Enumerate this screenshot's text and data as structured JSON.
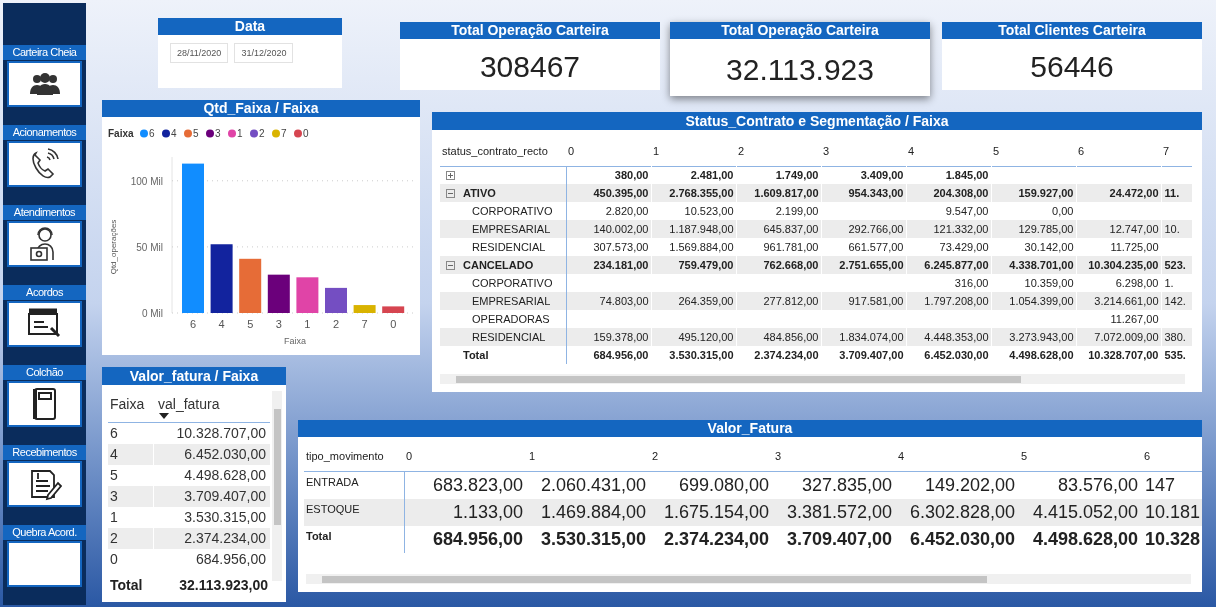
{
  "sidebar": {
    "items": [
      {
        "label": "Carteira Cheia"
      },
      {
        "label": "Acionamentos"
      },
      {
        "label": "Atendimentos"
      },
      {
        "label": "Acordos"
      },
      {
        "label": "Colchão"
      },
      {
        "label": "Recebimentos"
      },
      {
        "label": "Quebra Acord."
      }
    ]
  },
  "date_filter": {
    "title": "Data",
    "start": "28/11/2020",
    "end": "31/12/2020"
  },
  "kpi_cards": [
    {
      "title": "Total Operação Carteira",
      "value": "308467",
      "highlighted": false
    },
    {
      "title": "Total Operação Carteira",
      "value": "32.113.923",
      "highlighted": true
    },
    {
      "title": "Total Clientes Carteira",
      "value": "56446",
      "highlighted": false
    }
  ],
  "qtd_chart": {
    "legend": {
      "title": "Faixa",
      "items": [
        {
          "label": "6",
          "color": "#118dff"
        },
        {
          "label": "4",
          "color": "#12239e"
        },
        {
          "label": "5",
          "color": "#e66c37"
        },
        {
          "label": "3",
          "color": "#6b007b"
        },
        {
          "label": "1",
          "color": "#e044a7"
        },
        {
          "label": "2",
          "color": "#744ec2"
        },
        {
          "label": "7",
          "color": "#d9b300"
        },
        {
          "label": "0",
          "color": "#d64550"
        }
      ]
    },
    "chart_data": {
      "type": "bar",
      "title": "Qtd_Faixa / Faixa",
      "xlabel": "Faixa",
      "ylabel": "Qtd_operações",
      "categories": [
        "6",
        "4",
        "5",
        "3",
        "1",
        "2",
        "7",
        "0"
      ],
      "values": [
        113,
        52,
        41,
        29,
        27,
        19,
        6,
        5
      ],
      "ylim": [
        0,
        118
      ],
      "yticks": [
        {
          "value": 0,
          "label": "0 Mil"
        },
        {
          "value": 50,
          "label": "50 Mil"
        },
        {
          "value": 100,
          "label": "100 Mil"
        }
      ]
    }
  },
  "status_matrix": {
    "title": "Status_Contrato e Segmentação / Faixa",
    "row_header": "status_contrato_recto",
    "columns": [
      "0",
      "1",
      "2",
      "3",
      "4",
      "5",
      "6",
      "7"
    ],
    "rows": [
      {
        "expanded": false,
        "values": {
          "c0": "380,00",
          "c1": "2.481,00",
          "c2": "1.749,00",
          "c3": "3.409,00",
          "c4": "1.845,00"
        }
      },
      {
        "label": "ATIVO",
        "expanded": true,
        "values": {
          "c0": "450.395,00",
          "c1": "2.768.355,00",
          "c2": "1.609.817,00",
          "c3": "954.343,00",
          "c4": "204.308,00",
          "c5": "159.927,00",
          "c6": "24.472,00",
          "c7": "11."
        },
        "children": [
          {
            "label": "CORPORATIVO",
            "values": {
              "c0": "2.820,00",
              "c1": "10.523,00",
              "c2": "2.199,00",
              "c4": "9.547,00",
              "c5": "0,00"
            }
          },
          {
            "label": "EMPRESARIAL",
            "values": {
              "c0": "140.002,00",
              "c1": "1.187.948,00",
              "c2": "645.837,00",
              "c3": "292.766,00",
              "c4": "121.332,00",
              "c5": "129.785,00",
              "c6": "12.747,00",
              "c7": "10."
            }
          },
          {
            "label": "RESIDENCIAL",
            "values": {
              "c0": "307.573,00",
              "c1": "1.569.884,00",
              "c2": "961.781,00",
              "c3": "661.577,00",
              "c4": "73.429,00",
              "c5": "30.142,00",
              "c6": "11.725,00"
            }
          }
        ]
      },
      {
        "label": "CANCELADO",
        "expanded": true,
        "values": {
          "c0": "234.181,00",
          "c1": "759.479,00",
          "c2": "762.668,00",
          "c3": "2.751.655,00",
          "c4": "6.245.877,00",
          "c5": "4.338.701,00",
          "c6": "10.304.235,00",
          "c7": "523."
        },
        "children": [
          {
            "label": "CORPORATIVO",
            "values": {
              "c4": "316,00",
              "c5": "10.359,00",
              "c6": "6.298,00",
              "c7": "1."
            }
          },
          {
            "label": "EMPRESARIAL",
            "values": {
              "c0": "74.803,00",
              "c1": "264.359,00",
              "c2": "277.812,00",
              "c3": "917.581,00",
              "c4": "1.797.208,00",
              "c5": "1.054.399,00",
              "c6": "3.214.661,00",
              "c7": "142."
            }
          },
          {
            "label": "OPERADORAS",
            "values": {
              "c6": "11.267,00"
            }
          },
          {
            "label": "RESIDENCIAL",
            "values": {
              "c0": "159.378,00",
              "c1": "495.120,00",
              "c2": "484.856,00",
              "c3": "1.834.074,00",
              "c4": "4.448.353,00",
              "c5": "3.273.943,00",
              "c6": "7.072.009,00",
              "c7": "380."
            }
          }
        ]
      }
    ],
    "total": {
      "label": "Total",
      "values": {
        "c0": "684.956,00",
        "c1": "3.530.315,00",
        "c2": "2.374.234,00",
        "c3": "3.709.407,00",
        "c4": "6.452.030,00",
        "c5": "4.498.628,00",
        "c6": "10.328.707,00",
        "c7": "535."
      }
    }
  },
  "valor_fatura_table": {
    "title": "Valor_fatura / Faixa",
    "columns": [
      "Faixa",
      "val_fatura"
    ],
    "rows": [
      {
        "faixa": "6",
        "val_fatura": "10.328.707,00"
      },
      {
        "faixa": "4",
        "val_fatura": "6.452.030,00"
      },
      {
        "faixa": "5",
        "val_fatura": "4.498.628,00"
      },
      {
        "faixa": "3",
        "val_fatura": "3.709.407,00"
      },
      {
        "faixa": "1",
        "val_fatura": "3.530.315,00"
      },
      {
        "faixa": "2",
        "val_fatura": "2.374.234,00"
      },
      {
        "faixa": "0",
        "val_fatura": "684.956,00"
      }
    ],
    "total": {
      "faixa": "Total",
      "val_fatura": "32.113.923,00"
    }
  },
  "valor_fatura_matrix": {
    "title": "Valor_Fatura",
    "row_header": "tipo_movimento",
    "columns": [
      "0",
      "1",
      "2",
      "3",
      "4",
      "5",
      "6"
    ],
    "rows": [
      {
        "label": "ENTRADA",
        "values": [
          "683.823,00",
          "2.060.431,00",
          "699.080,00",
          "327.835,00",
          "149.202,00",
          "83.576,00",
          "147"
        ]
      },
      {
        "label": "ESTOQUE",
        "values": [
          "1.133,00",
          "1.469.884,00",
          "1.675.154,00",
          "3.381.572,00",
          "6.302.828,00",
          "4.415.052,00",
          "10.181"
        ]
      }
    ],
    "total": {
      "label": "Total",
      "values": [
        "684.956,00",
        "3.530.315,00",
        "2.374.234,00",
        "3.709.407,00",
        "6.452.030,00",
        "4.498.628,00",
        "10.328"
      ]
    }
  }
}
